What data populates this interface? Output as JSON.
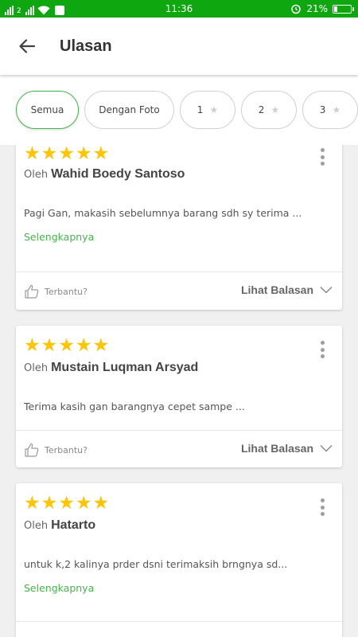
{
  "status_bar": {
    "time": "11:36",
    "battery_text": "21%",
    "battery_level": 0.21,
    "signal_label": "2"
  },
  "header": {
    "title": "Ulasan",
    "back_icon": "arrow-back-icon"
  },
  "filters": {
    "chips": [
      {
        "label": "Semua",
        "active": true,
        "icon": ""
      },
      {
        "label": "Dengan Foto",
        "active": false,
        "icon": ""
      },
      {
        "label": "1",
        "active": false,
        "icon": "star-icon"
      },
      {
        "label": "2",
        "active": false,
        "icon": "star-icon"
      },
      {
        "label": "3",
        "active": false,
        "icon": "star-icon"
      }
    ]
  },
  "reviews": [
    {
      "rating": 5,
      "by_prefix": "Oleh",
      "author": "Wahid Boedy Santoso",
      "text": "Pagi Gan, makasih sebelumnya barang sdh sy terima ...",
      "more_label": "Selengkapnya",
      "helpful_label": "Terbantu?",
      "replies_label": "Lihat Balasan"
    },
    {
      "rating": 5,
      "by_prefix": "Oleh",
      "author": "Mustain Luqman Arsyad",
      "text": "Terima kasih gan barangnya cepet sampe ...",
      "more_label": "",
      "helpful_label": "Terbantu?",
      "replies_label": "Lihat Balasan"
    },
    {
      "rating": 5,
      "by_prefix": "Oleh",
      "author": "Hatarto",
      "text": "untuk k,2 kalinya prder dsni terimaksih brngnya sd...",
      "more_label": "Selengkapnya",
      "helpful_label": "",
      "replies_label": ""
    }
  ],
  "colors": {
    "status_bar": "#0fa70f",
    "accent_green": "#42b549",
    "star": "#ffc402",
    "star_inactive": "#cfcfcf"
  }
}
